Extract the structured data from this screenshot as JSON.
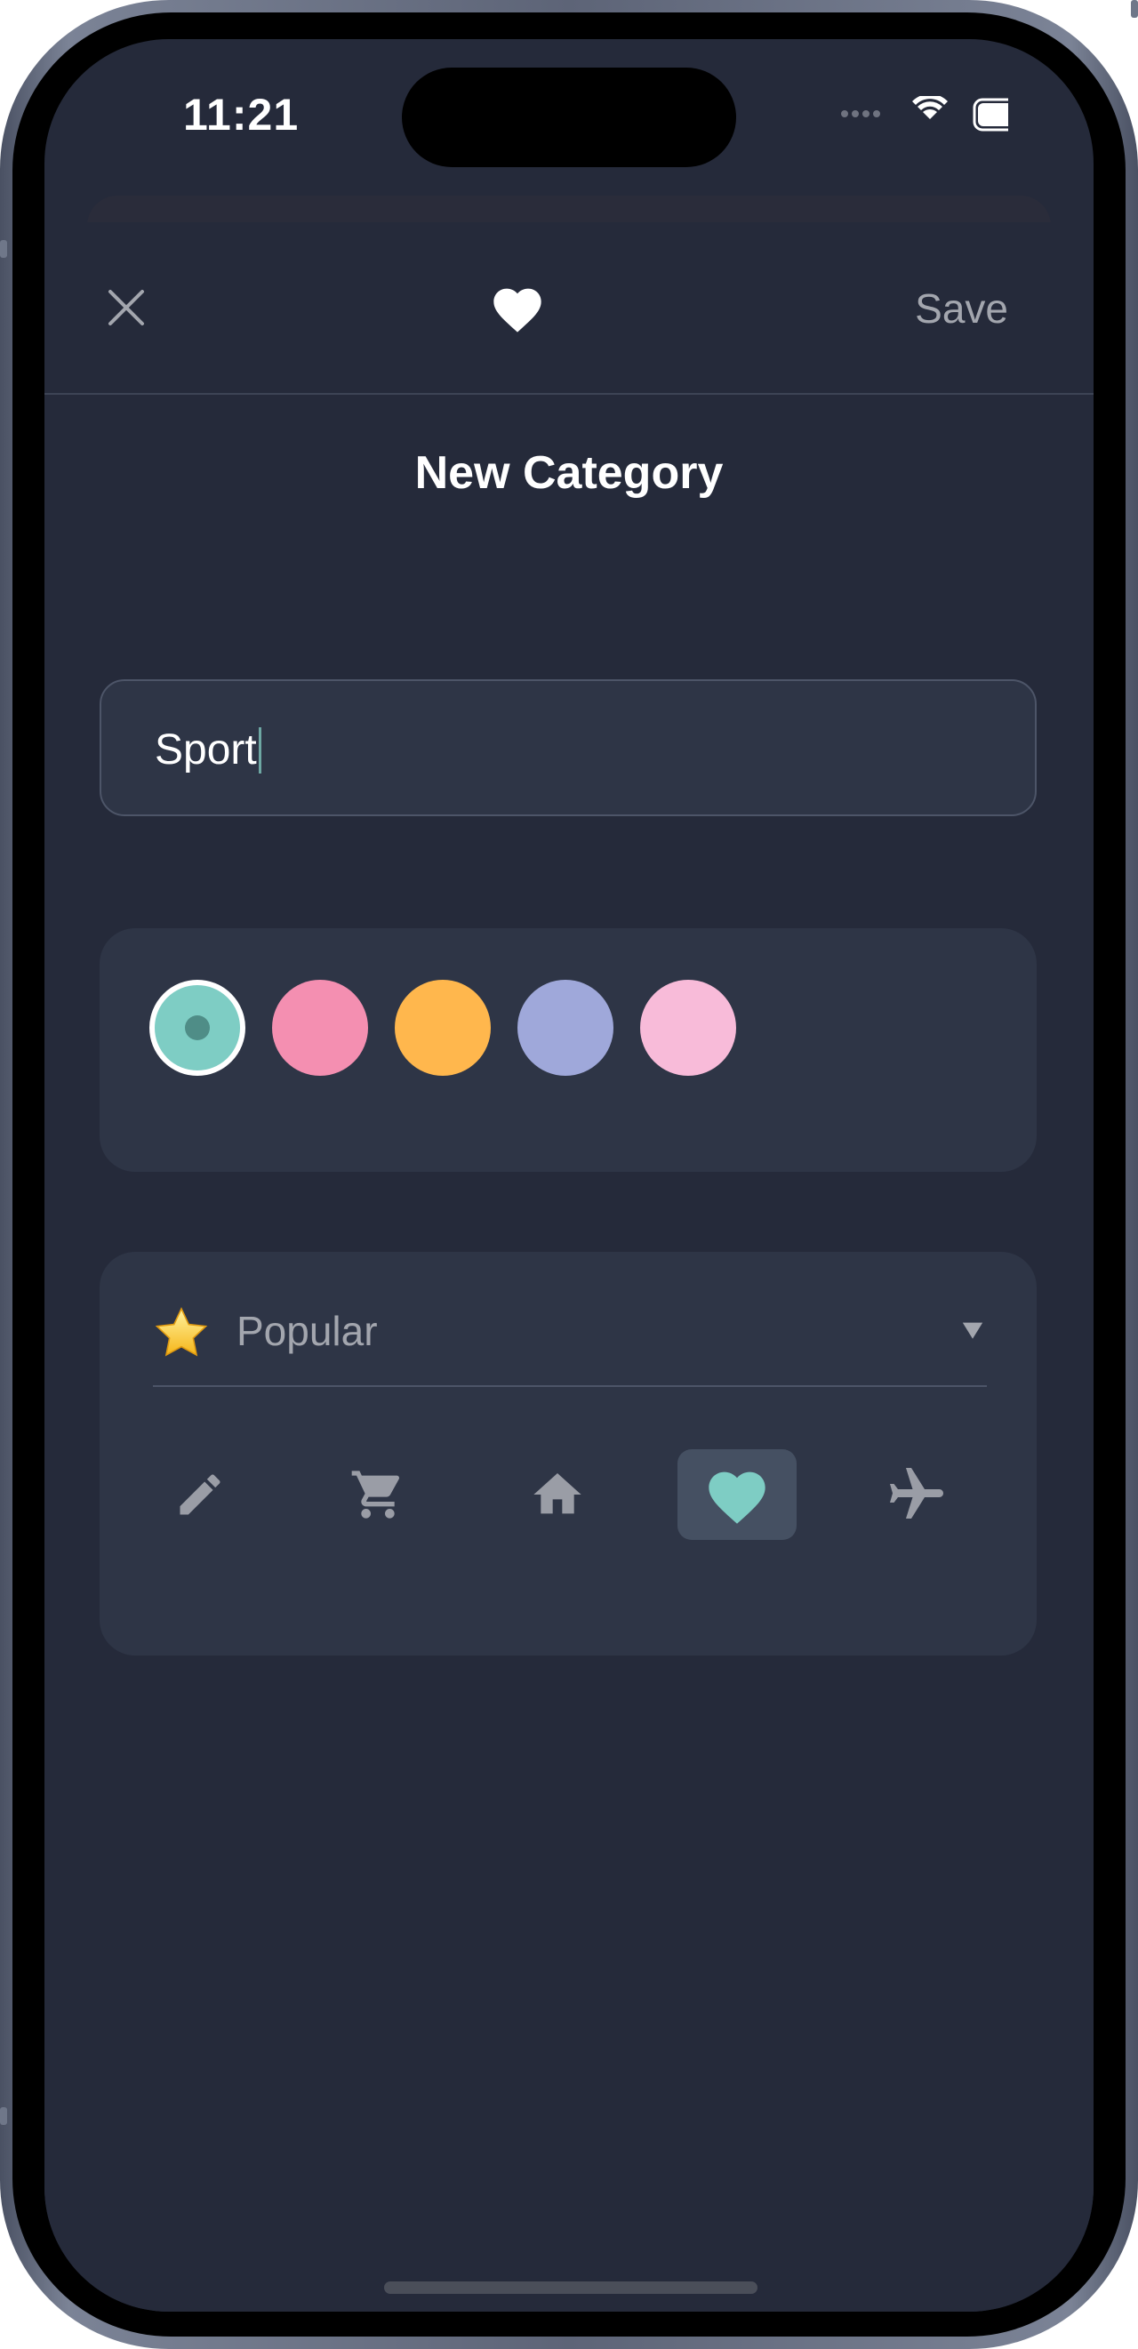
{
  "status_bar": {
    "time": "11:21"
  },
  "header": {
    "close_icon": "close-icon",
    "center_icon": "heart-icon",
    "save_label": "Save"
  },
  "page": {
    "title": "New Category"
  },
  "name_field": {
    "value": "Sport"
  },
  "colors": {
    "swatches": [
      "#7ecdc4",
      "#f48fb1",
      "#ffb74d",
      "#9fa8da",
      "#f8bbd9"
    ],
    "selected_index": 0
  },
  "icon_picker": {
    "category_emoji": "⭐",
    "category_label": "Popular",
    "icons": [
      "pencil-icon",
      "cart-icon",
      "home-icon",
      "heart-icon",
      "airplane-icon"
    ],
    "selected_index": 3
  },
  "theme": {
    "background": "#252a3a",
    "card": "#2e3546",
    "accent": "#7ecdc4",
    "muted_text": "#a3a6ae"
  }
}
